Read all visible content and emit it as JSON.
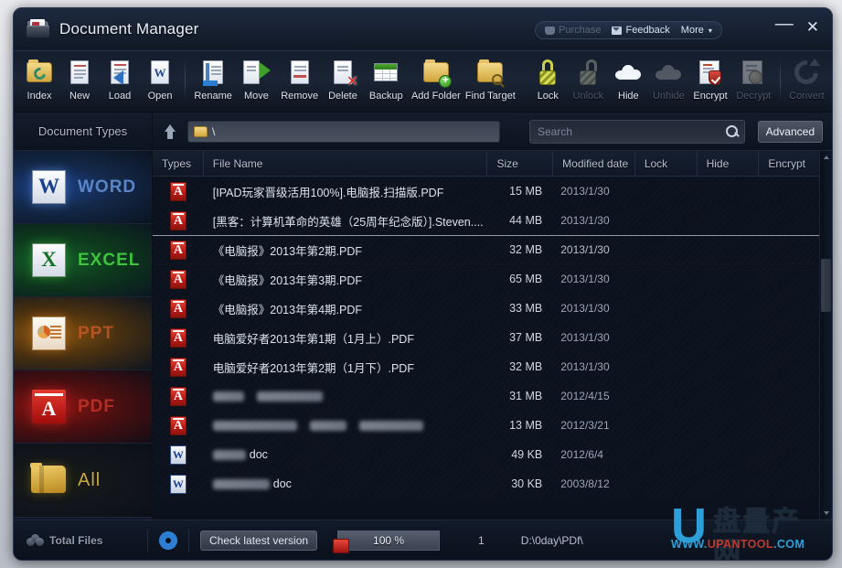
{
  "window": {
    "title": "Document Manager",
    "app_icon": "folder-document-icon",
    "minimize_label": "—",
    "close_label": "✕"
  },
  "title_actions": [
    {
      "label": "Purchase",
      "icon": "cart-icon",
      "enabled": false
    },
    {
      "label": "Feedback",
      "icon": "mail-icon",
      "enabled": true
    },
    {
      "label": "More",
      "icon": "chevron-down-icon",
      "enabled": true,
      "caret": "▾"
    }
  ],
  "toolbar": {
    "groups": [
      {
        "items": [
          {
            "label": "Index",
            "icon": "index-folder-icon",
            "enabled": true
          },
          {
            "label": "New",
            "icon": "new-document-icon",
            "enabled": true
          },
          {
            "label": "Load",
            "icon": "load-document-icon",
            "enabled": true
          },
          {
            "label": "Open",
            "icon": "open-word-icon",
            "enabled": true
          }
        ]
      },
      {
        "items": [
          {
            "label": "Rename",
            "icon": "rename-icon",
            "enabled": true
          },
          {
            "label": "Move",
            "icon": "move-icon",
            "enabled": true
          },
          {
            "label": "Remove",
            "icon": "remove-icon",
            "enabled": true
          },
          {
            "label": "Delete",
            "icon": "delete-icon",
            "enabled": true
          },
          {
            "label": "Backup",
            "icon": "backup-table-icon",
            "enabled": true
          },
          {
            "label": "Add Folder",
            "icon": "add-folder-icon",
            "enabled": true
          },
          {
            "label": "Find Target",
            "icon": "find-folder-icon",
            "enabled": true
          }
        ]
      },
      {
        "items": [
          {
            "label": "Lock",
            "icon": "lock-icon",
            "enabled": true
          },
          {
            "label": "Unlock",
            "icon": "unlock-icon",
            "enabled": false
          },
          {
            "label": "Hide",
            "icon": "cloud-hide-icon",
            "enabled": true
          },
          {
            "label": "Unhide",
            "icon": "cloud-unhide-icon",
            "enabled": false
          },
          {
            "label": "Encrypt",
            "icon": "encrypt-shield-icon",
            "enabled": true
          },
          {
            "label": "Decrypt",
            "icon": "decrypt-icon",
            "enabled": false
          }
        ]
      },
      {
        "items": [
          {
            "label": "Convert",
            "icon": "convert-refresh-icon",
            "enabled": false
          }
        ]
      }
    ]
  },
  "sidebar": {
    "title": "Document Types",
    "items": [
      {
        "label": "WORD",
        "icon": "word-icon",
        "key": "word"
      },
      {
        "label": "EXCEL",
        "icon": "excel-icon",
        "key": "excel"
      },
      {
        "label": "PPT",
        "icon": "ppt-icon",
        "key": "ppt"
      },
      {
        "label": "PDF",
        "icon": "pdf-icon",
        "key": "pdf"
      },
      {
        "label": "All",
        "icon": "folder-icon",
        "key": "all"
      }
    ],
    "footer": {
      "label": "Total Files",
      "icon": "total-files-icon"
    }
  },
  "pathbar": {
    "up_icon": "up-arrow-icon",
    "folder_icon": "folder-icon",
    "path_value": "\\",
    "search_placeholder": "Search",
    "search_value": "",
    "search_icon": "search-icon",
    "advanced_label": "Advanced"
  },
  "table": {
    "columns": [
      {
        "key": "type",
        "label": "Types"
      },
      {
        "key": "name",
        "label": "File Name"
      },
      {
        "key": "size",
        "label": "Size"
      },
      {
        "key": "date",
        "label": "Modified date"
      },
      {
        "key": "lock",
        "label": "Lock"
      },
      {
        "key": "hide",
        "label": "Hide"
      },
      {
        "key": "encrypt",
        "label": "Encrypt"
      }
    ],
    "rows": [
      {
        "icon": "pdf-file-icon",
        "name": "[IPAD玩家晋级活用100%].电脑报.扫描版.PDF",
        "size": "15 MB",
        "date": "2013/1/30",
        "lock": "",
        "hide": "",
        "encrypt": "",
        "selected": false,
        "redacted": false
      },
      {
        "icon": "pdf-file-icon",
        "name": "[黑客：计算机革命的英雄（25周年纪念版）].Steven....",
        "size": "44 MB",
        "date": "2013/1/30",
        "lock": "",
        "hide": "",
        "encrypt": "",
        "selected": false,
        "redacted": false
      },
      {
        "icon": "pdf-file-icon",
        "name": "《电脑报》2013年第2期.PDF",
        "size": "32 MB",
        "date": "2013/1/30",
        "lock": "",
        "hide": "",
        "encrypt": "",
        "selected": true,
        "redacted": false
      },
      {
        "icon": "pdf-file-icon",
        "name": "《电脑报》2013年第3期.PDF",
        "size": "65 MB",
        "date": "2013/1/30",
        "lock": "",
        "hide": "",
        "encrypt": "",
        "selected": false,
        "redacted": false
      },
      {
        "icon": "pdf-file-icon",
        "name": "《电脑报》2013年第4期.PDF",
        "size": "33 MB",
        "date": "2013/1/30",
        "lock": "",
        "hide": "",
        "encrypt": "",
        "selected": false,
        "redacted": false
      },
      {
        "icon": "pdf-file-icon",
        "name": "电脑爱好者2013年第1期（1月上）.PDF",
        "size": "37 MB",
        "date": "2013/1/30",
        "lock": "",
        "hide": "",
        "encrypt": "",
        "selected": false,
        "redacted": false
      },
      {
        "icon": "pdf-file-icon",
        "name": "电脑爱好者2013年第2期（1月下）.PDF",
        "size": "32 MB",
        "date": "2013/1/30",
        "lock": "",
        "hide": "",
        "encrypt": "",
        "selected": false,
        "redacted": false
      },
      {
        "icon": "pdf-file-icon",
        "name": "",
        "size": "31 MB",
        "date": "2012/4/15",
        "lock": "",
        "hide": "",
        "encrypt": "",
        "selected": false,
        "redacted": true,
        "redact_widths": [
          34,
          72
        ]
      },
      {
        "icon": "pdf-file-icon",
        "name": "",
        "size": "13 MB",
        "date": "2012/3/21",
        "lock": "",
        "hide": "",
        "encrypt": "",
        "selected": false,
        "redacted": true,
        "redact_widths": [
          92,
          40,
          70
        ]
      },
      {
        "icon": "word-file-icon",
        "name": "doc",
        "size": "49 KB",
        "date": "2012/6/4",
        "lock": "",
        "hide": "",
        "encrypt": "",
        "selected": false,
        "redacted": true,
        "redact_widths": [
          36
        ]
      },
      {
        "icon": "word-file-icon",
        "name": "doc",
        "size": "30 KB",
        "date": "2003/8/12",
        "lock": "",
        "hide": "",
        "encrypt": "",
        "selected": false,
        "redacted": true,
        "redact_widths": [
          62
        ]
      }
    ]
  },
  "statusbar": {
    "total_files_label": "Total Files",
    "gear_icon": "gear-icon",
    "check_version_label": "Check latest version",
    "progress_percent": "100 %",
    "progress_value": 100,
    "count": "1",
    "current_path": "D:\\0day\\PDf\\"
  },
  "watermark": {
    "logo_letter": "U",
    "cn_text": "盘量产网",
    "url_blue_1": "WWW.",
    "url_red": "UPANTOOL",
    "url_blue_2": ".COM"
  },
  "colors": {
    "accent_blue": "#2d9fd8",
    "pdf_red": "#c0392b",
    "word_blue": "#1b3f8f",
    "excel_green": "#3fc33f",
    "ppt_orange": "#cf5c28",
    "window_bg": "#0f1724"
  }
}
